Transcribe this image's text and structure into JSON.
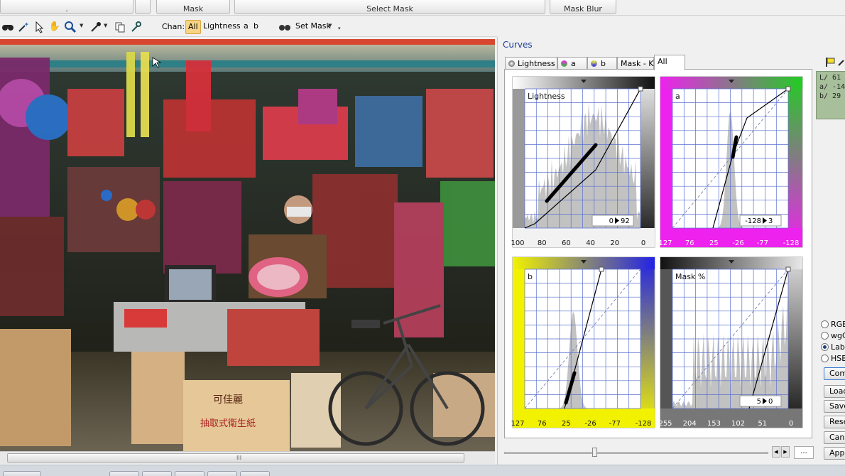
{
  "top_groups": {
    "mask": "Mask",
    "select_mask": "Select Mask",
    "mask_blur": "Mask Blur",
    "first": "."
  },
  "toolbar": {
    "chan_label": "Chan:",
    "channels": [
      "All",
      "Lightness",
      "a",
      "b"
    ],
    "set_mask": "Set Mask"
  },
  "curves": {
    "title": "Curves",
    "tabs": [
      "Lightness",
      "a",
      "b",
      "Mask - K",
      "All"
    ],
    "charts": [
      {
        "label": "Lightness",
        "ticks": [
          "100",
          "80",
          "60",
          "40",
          "20",
          "0"
        ],
        "io_in": "0",
        "io_out": "92"
      },
      {
        "label": "a",
        "ticks": [
          "127",
          "76",
          "25",
          "-26",
          "-77",
          "-128"
        ],
        "io_in": "-128",
        "io_out": "3"
      },
      {
        "label": "b",
        "ticks": [
          "127",
          "76",
          "25",
          "-26",
          "-77",
          "-128"
        ]
      },
      {
        "label": "Mask %",
        "ticks": [
          "255",
          "204",
          "153",
          "102",
          "51",
          "0"
        ],
        "io_in": "5",
        "io_out": "0"
      }
    ],
    "readout": {
      "l": "L/ 61",
      "a": "a/ -14",
      "b": "b/ 29"
    },
    "radios": [
      "RGB",
      "wgG",
      "Lab",
      "HSB"
    ],
    "buttons": [
      "Comp",
      "Load",
      "Save",
      "Reset",
      "Cancel",
      "Apply"
    ],
    "dots": "...",
    "scrollbar_grip": "III"
  }
}
